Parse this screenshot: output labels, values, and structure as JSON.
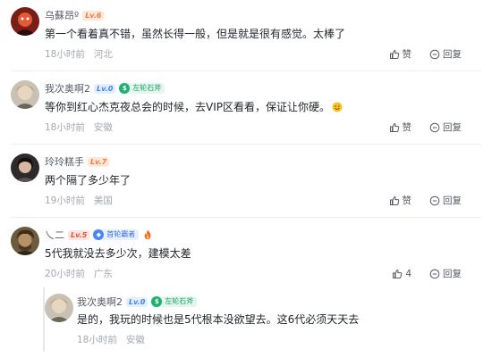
{
  "colors": {
    "username": "#555a64",
    "text": "#1f2329",
    "meta": "#a3a8b1",
    "divider": "#eceef1"
  },
  "action_labels": {
    "like": "赞",
    "reply": "回复"
  },
  "comments": [
    {
      "user": "乌蘇昂º",
      "level": "Lv.6",
      "text": "第一个看着真不错，虽然长得一般，但是就是很有感觉。太棒了",
      "time": "18小时前",
      "location": "河北",
      "like_icon": "thumbs-up-icon",
      "reply_icon": "reply-bubble-icon"
    },
    {
      "user": "我次奥啊2",
      "level": "Lv.0",
      "badge": "左轮石斧",
      "badge_icon": "green-dollar-badge-icon",
      "text": "等你到红心杰克夜总会的时候，去VIP区看看，保证让你硬。",
      "emoji": "smiling-face-emoji",
      "time": "18小时前",
      "location": "安徽"
    },
    {
      "user": "玲玲糕手",
      "level": "Lv.7",
      "text": "两个隔了多少年了",
      "time": "19小时前",
      "location": "美国"
    },
    {
      "user": "乀二",
      "level": "Lv.5",
      "badge": "首轮霸者",
      "badge_icon": "blue-diamond-badge-icon",
      "extra_icon": "fire-icon",
      "text": "5代我就没去多少次，建模太差",
      "time": "20小时前",
      "location": "广东",
      "likes": "4"
    },
    {
      "user": "我次奥啊2",
      "level": "Lv.0",
      "badge": "左轮石斧",
      "badge_icon": "green-dollar-badge-icon",
      "text": "是的，我玩的时候也是5代根本没欲望去。这6代必须天天去",
      "time": "18小时前",
      "location": "安徽",
      "is_reply": true
    }
  ]
}
